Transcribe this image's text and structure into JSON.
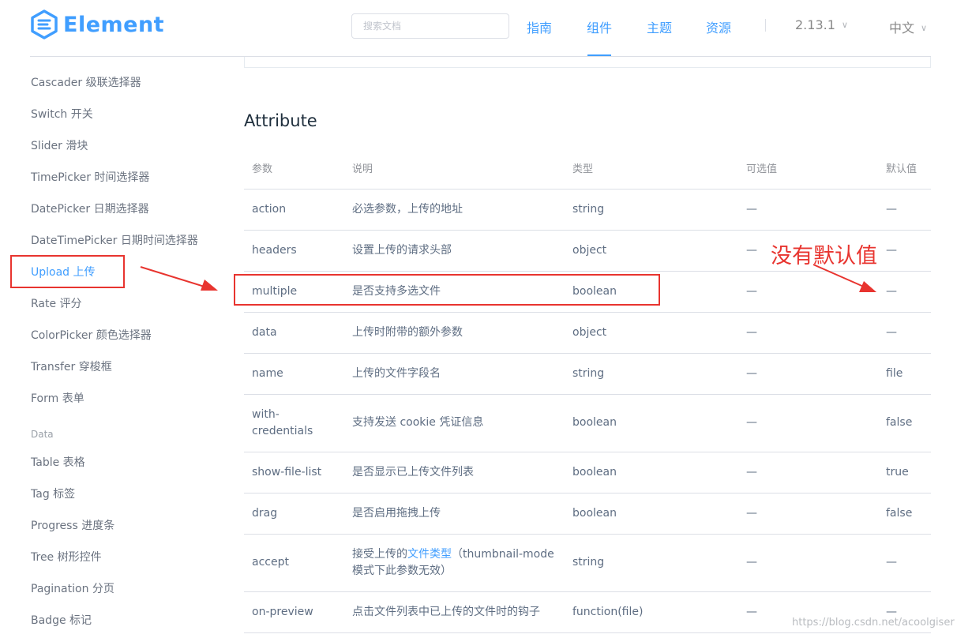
{
  "header": {
    "logo_text": "Element",
    "search_placeholder": "搜索文档",
    "nav": [
      "指南",
      "组件",
      "主题",
      "资源"
    ],
    "active_nav": "组件",
    "version": "2.13.1",
    "language": "中文"
  },
  "sidebar": {
    "items_before": [
      "Cascader 级联选择器",
      "Switch 开关",
      "Slider 滑块",
      "TimePicker 时间选择器",
      "DatePicker 日期选择器",
      "DateTimePicker 日期时间选择器",
      "Upload 上传",
      "Rate 评分",
      "ColorPicker 颜色选择器",
      "Transfer 穿梭框",
      "Form 表单"
    ],
    "group_title": "Data",
    "items_after": [
      "Table 表格",
      "Tag 标签",
      "Progress 进度条",
      "Tree 树形控件",
      "Pagination 分页",
      "Badge 标记"
    ],
    "active_item": "Upload 上传"
  },
  "main": {
    "section_title": "Attribute",
    "table": {
      "headers": [
        "参数",
        "说明",
        "类型",
        "可选值",
        "默认值"
      ],
      "rows": [
        {
          "param": "action",
          "desc": "必选参数，上传的地址",
          "type": "string",
          "options": "—",
          "default": "—"
        },
        {
          "param": "headers",
          "desc": "设置上传的请求头部",
          "type": "object",
          "options": "—",
          "default": "—"
        },
        {
          "param": "multiple",
          "desc": "是否支持多选文件",
          "type": "boolean",
          "options": "—",
          "default": "—"
        },
        {
          "param": "data",
          "desc": "上传时附带的额外参数",
          "type": "object",
          "options": "—",
          "default": "—"
        },
        {
          "param": "name",
          "desc": "上传的文件字段名",
          "type": "string",
          "options": "—",
          "default": "file"
        },
        {
          "param_l1": "with-",
          "param_l2": "credentials",
          "desc": "支持发送 cookie 凭证信息",
          "type": "boolean",
          "options": "—",
          "default": "false"
        },
        {
          "param": "show-file-list",
          "desc": "是否显示已上传文件列表",
          "type": "boolean",
          "options": "—",
          "default": "true"
        },
        {
          "param": "drag",
          "desc": "是否启用拖拽上传",
          "type": "boolean",
          "options": "—",
          "default": "false"
        },
        {
          "param": "accept",
          "desc_pre": "接受上传的",
          "desc_link": "文件类型",
          "desc_post_l1": "（thumbnail-mode",
          "desc_post_l2": "模式下此参数无效）",
          "type": "string",
          "options": "—",
          "default": "—"
        },
        {
          "param": "on-preview",
          "desc": "点击文件列表中已上传的文件时的钩子",
          "type": "function(file)",
          "options": "—",
          "default": "—"
        }
      ]
    }
  },
  "annotation": {
    "text": "没有默认值",
    "color": "#e8342f"
  },
  "watermark": "https://blog.csdn.net/acoolgiser",
  "colors": {
    "accent": "#409eff",
    "annotation_red": "#e8342f"
  }
}
